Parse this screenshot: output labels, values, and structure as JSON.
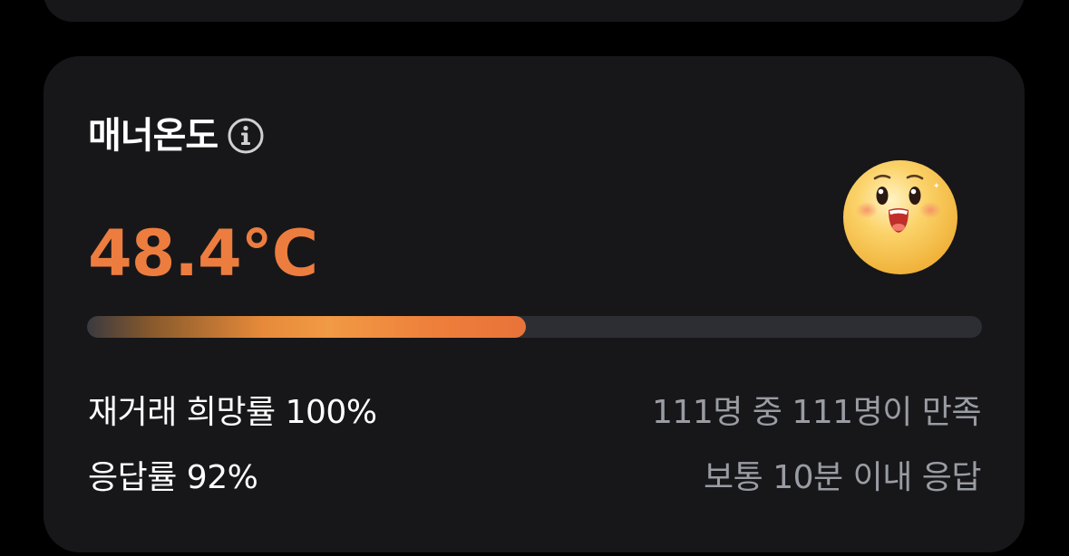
{
  "manner": {
    "title": "매너온도",
    "info_icon": "info-circle-icon",
    "temperature": "48.4°C",
    "temperature_fraction": 0.49,
    "face_icon": "surprised-face-icon",
    "accent_color": "#ed7d3f"
  },
  "stats": {
    "retrade_label": "재거래 희망률 100%",
    "retrade_detail": "111명 중 111명이 만족",
    "response_label": "응답률 92%",
    "response_detail": "보통 10분 이내 응답"
  }
}
